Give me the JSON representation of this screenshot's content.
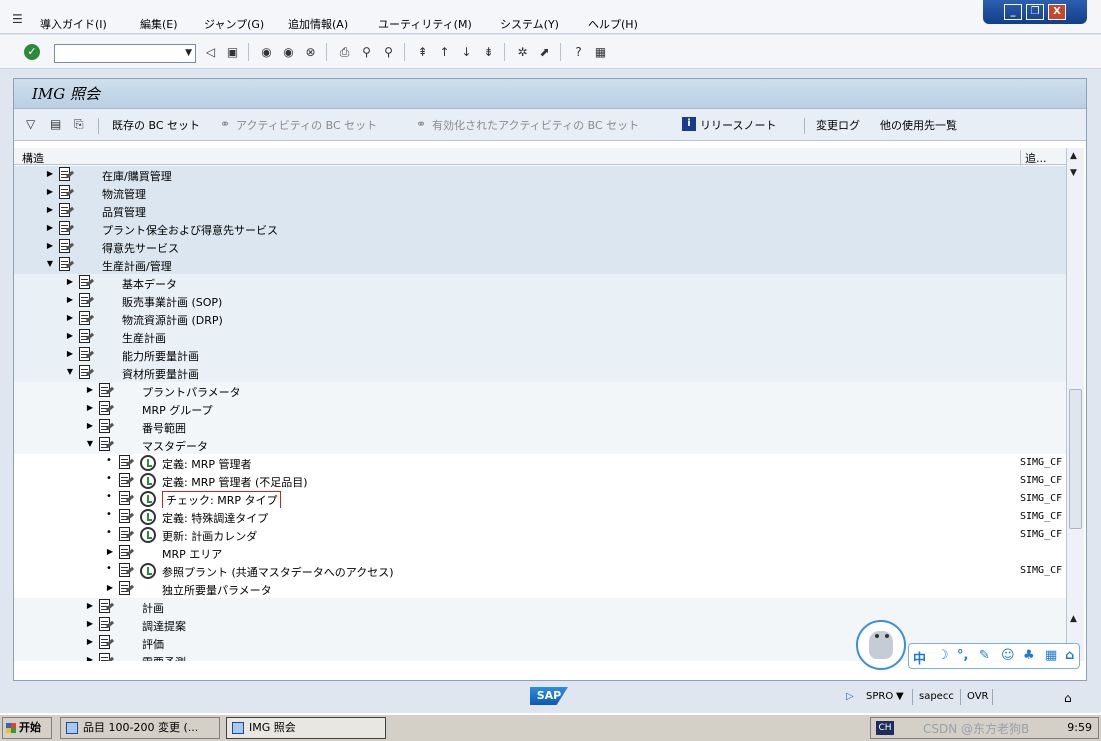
{
  "menubar": {
    "items": [
      "導入ガイド(I)",
      "編集(E)",
      "ジャンプ(G)",
      "追加情報(A)",
      "ユーティリティ(M)",
      "システム(Y)",
      "ヘルプ(H)"
    ]
  },
  "window_controls": {
    "minimize": "_",
    "restore": "❐",
    "close": "X"
  },
  "command_field": {
    "value": "",
    "placeholder": ""
  },
  "screen": {
    "title": "IMG 照会"
  },
  "app_toolbar": {
    "existing_bc_sets": "既存の BC セット",
    "activity_bc_sets": "アクティビティの BC セット",
    "activated_bc_sets": "有効化されたアクティビティの BC セット",
    "release_notes": "リリースノート",
    "change_log": "変更ログ",
    "where_used": "他の使用先一覧"
  },
  "tree": {
    "col_structure": "構造",
    "col_additional": "追..."
  },
  "tree_rows": [
    {
      "label": "在庫/購買管理",
      "expander": "▶",
      "cfg": ""
    },
    {
      "label": "物流管理",
      "expander": "▶",
      "cfg": ""
    },
    {
      "label": "品質管理",
      "expander": "▶",
      "cfg": ""
    },
    {
      "label": "プラント保全および得意先サービス",
      "expander": "▶",
      "cfg": ""
    },
    {
      "label": "得意先サービス",
      "expander": "▶",
      "cfg": ""
    },
    {
      "label": "生産計画/管理",
      "expander": "▼",
      "cfg": ""
    },
    {
      "label": "基本データ",
      "expander": "▶",
      "cfg": ""
    },
    {
      "label": "販売事業計画 (SOP)",
      "expander": "▶",
      "cfg": ""
    },
    {
      "label": "物流資源計画 (DRP)",
      "expander": "▶",
      "cfg": ""
    },
    {
      "label": "生産計画",
      "expander": "▶",
      "cfg": ""
    },
    {
      "label": "能力所要量計画",
      "expander": "▶",
      "cfg": ""
    },
    {
      "label": "資材所要量計画",
      "expander": "▼",
      "cfg": ""
    },
    {
      "label": "プラントパラメータ",
      "expander": "▶",
      "cfg": ""
    },
    {
      "label": "MRP グループ",
      "expander": "▶",
      "cfg": ""
    },
    {
      "label": "番号範囲",
      "expander": "▶",
      "cfg": ""
    },
    {
      "label": "マスタデータ",
      "expander": "▼",
      "cfg": ""
    },
    {
      "label": "定義: MRP 管理者",
      "expander": "•",
      "cfg": "SIMG_CF"
    },
    {
      "label": "定義: MRP 管理者 (不足品目)",
      "expander": "•",
      "cfg": "SIMG_CF"
    },
    {
      "label": "チェック: MRP タイプ",
      "expander": "•",
      "cfg": "SIMG_CF"
    },
    {
      "label": "定義: 特殊調達タイプ",
      "expander": "•",
      "cfg": "SIMG_CF"
    },
    {
      "label": "更新: 計画カレンダ",
      "expander": "•",
      "cfg": "SIMG_CF"
    },
    {
      "label": "MRP エリア",
      "expander": "▶",
      "cfg": ""
    },
    {
      "label": "参照プラント (共通マスタデータへのアクセス)",
      "expander": "•",
      "cfg": "SIMG_CF"
    },
    {
      "label": "独立所要量パラメータ",
      "expander": "▶",
      "cfg": ""
    },
    {
      "label": "計画",
      "expander": "▶",
      "cfg": ""
    },
    {
      "label": "調達提案",
      "expander": "▶",
      "cfg": ""
    },
    {
      "label": "評価",
      "expander": "▶",
      "cfg": ""
    },
    {
      "label": "需要予測",
      "expander": "▶",
      "cfg": ""
    }
  ],
  "statusbar": {
    "sap_logo": "SAP",
    "transaction": "SPRO",
    "server": "sapecc",
    "mode": "OVR"
  },
  "taskbar": {
    "start": "开始",
    "tasks": [
      "品目 100-200 変更 (...",
      "IMG 照会"
    ],
    "ime_indicator": "CH",
    "watermark": "CSDN @东方老狗B",
    "clock": "9:59"
  },
  "ime_bar": {
    "mode": "中",
    "icons": [
      "moon-icon",
      "punctuation-icon",
      "wrench-icon",
      "smiley-icon",
      "shirt-icon",
      "grid-icon",
      "lock-icon"
    ]
  },
  "colors": {
    "title_gradient": "#c4d7e9",
    "highlight_border": "#d02020",
    "accent_blue": "#1b7ad4"
  }
}
